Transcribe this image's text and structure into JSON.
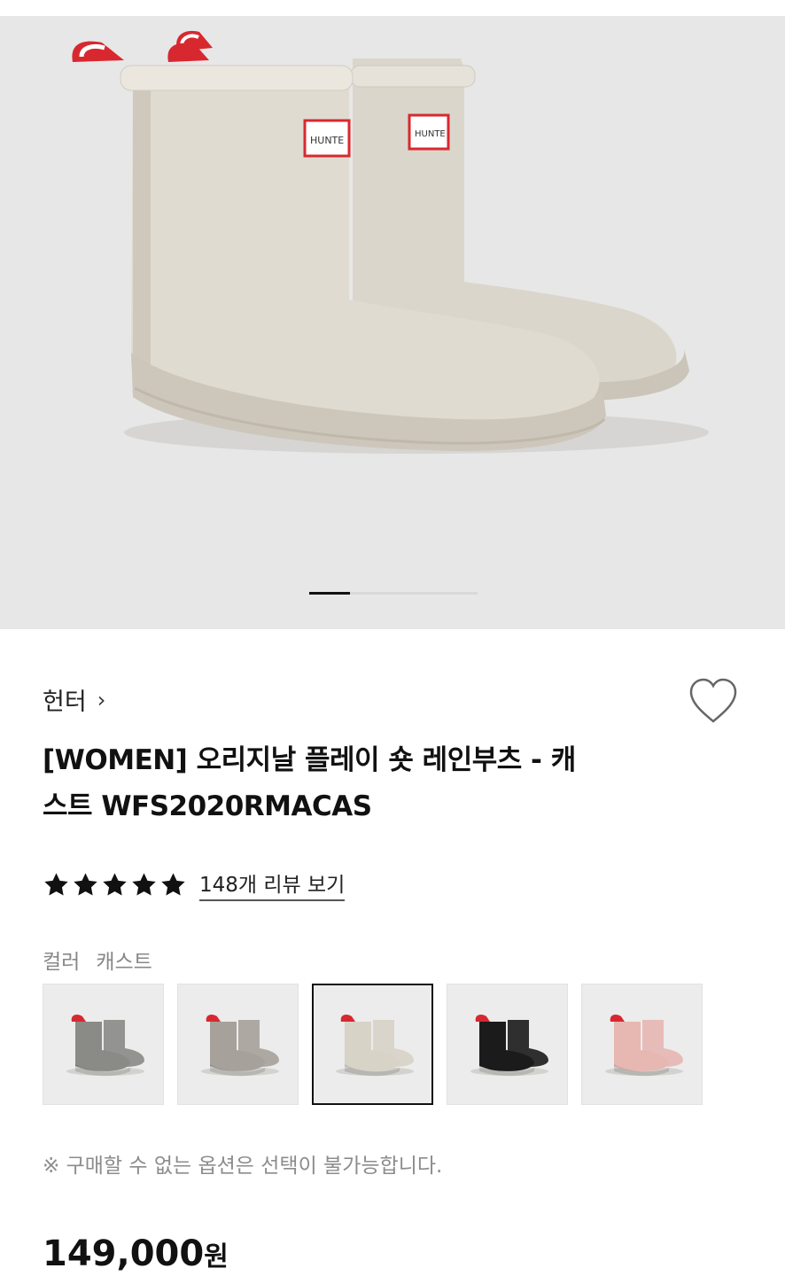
{
  "hero": {
    "image_alt": "",
    "logo_text": "HUNTER",
    "slide_indicator": {
      "current": 1
    }
  },
  "product": {
    "brand": "헌터",
    "brand_chevron": "›",
    "title_line1": "[WOMEN] 오리지날 플레이 숏 레인부츠 - 캐",
    "title_line2": "스트 WFS2020RMACAS",
    "rating_stars": 5,
    "reviews_label": "148개 리뷰 보기",
    "color_label": "컬러",
    "color_value": "캐스트",
    "swatches": [
      {
        "color": "#8a8a86",
        "selected": false
      },
      {
        "color": "#a7a19b",
        "selected": false
      },
      {
        "color": "#d8d3c7",
        "selected": true
      },
      {
        "color": "#1b1b1b",
        "selected": false
      },
      {
        "color": "#e7b7b2",
        "selected": false
      }
    ],
    "notice": "※ 구매할 수 없는 옵션은 선택이 불가능합니다.",
    "price_number": "149,000",
    "price_unit": "원"
  },
  "colors": {
    "boot": "#d9d4c9",
    "hero_bg": "#e7e7e7",
    "pull_tab_red": "#d8282f",
    "logo_red": "#d8282f"
  }
}
